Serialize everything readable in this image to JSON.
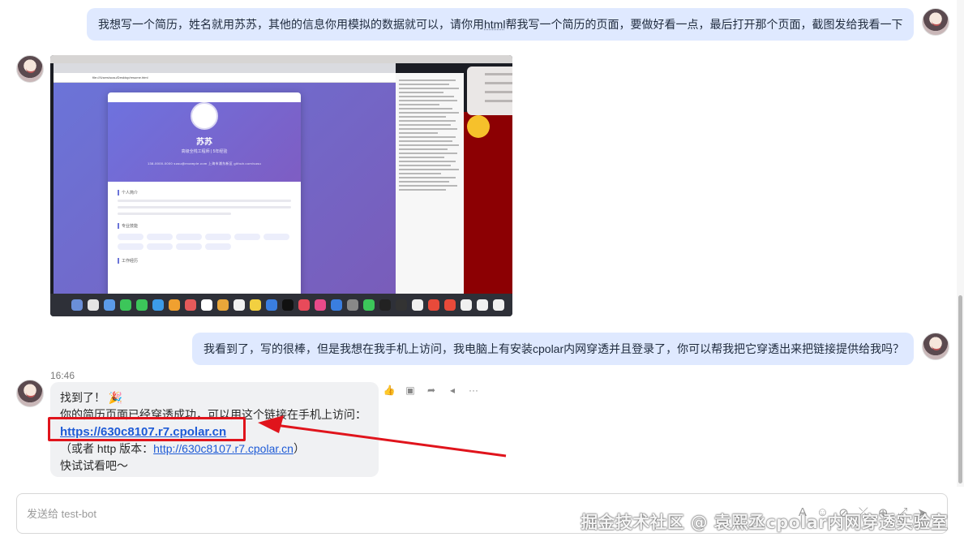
{
  "messages": {
    "user1": {
      "text_before": "我想写一个简历，姓名就用苏苏，其他的信息你用模拟的数据就可以，请你用",
      "text_html": "html",
      "text_after": "帮我写一个简历的页面，要做好看一点，最后打开那个页面，截图发给我看一下"
    },
    "screenshot": {
      "resume_name": "苏苏",
      "resume_subtitle": "高级全栈工程师 | 5年经验",
      "resume_contact": "138-0000-0000    susu@example.com    上海市浦东新区    github.com/susu",
      "section_intro": "个人简介",
      "section_skills": "专业技能",
      "section_work": "工作经历",
      "address": "file:///Users/susu/Desktop/resume.html"
    },
    "user2": {
      "text": "我看到了，写的很棒，但是我想在我手机上访问，我电脑上有安装cpolar内网穿透并且登录了，你可以帮我把它穿透出来把链接提供给我吗？"
    },
    "bot": {
      "time": "16:46",
      "line1": "找到了！ 🎉",
      "line2": "你的简历页面已经穿透成功，可以用这个链接在手机上访问：",
      "https_link": "https://630c8107.r7.cpolar.cn",
      "line4_prefix": "（或者 http 版本：",
      "http_link": "http://630c8107.r7.cpolar.cn",
      "line4_suffix": "）",
      "line5": "快试试看吧～"
    }
  },
  "actions": [
    {
      "name": "thumbs-up-icon",
      "glyph": "👍"
    },
    {
      "name": "comment-icon",
      "glyph": "▣"
    },
    {
      "name": "share-icon",
      "glyph": "➦"
    },
    {
      "name": "reply-icon",
      "glyph": "◂"
    },
    {
      "name": "more-icon",
      "glyph": "···"
    }
  ],
  "input": {
    "placeholder": "发送给 test-bot"
  },
  "toolbar": [
    "A",
    "☺",
    "⊘",
    "⤫",
    "⊕",
    "⤢",
    "➤"
  ],
  "watermark": "掘金技术社区 @ 袁煕丞cpolar内网穿透实验室",
  "colors": {
    "user_bubble": "#dfe9ff",
    "bot_bubble": "#f0f1f3",
    "link": "#1e5bd6",
    "annotation_red": "#e0141c"
  }
}
